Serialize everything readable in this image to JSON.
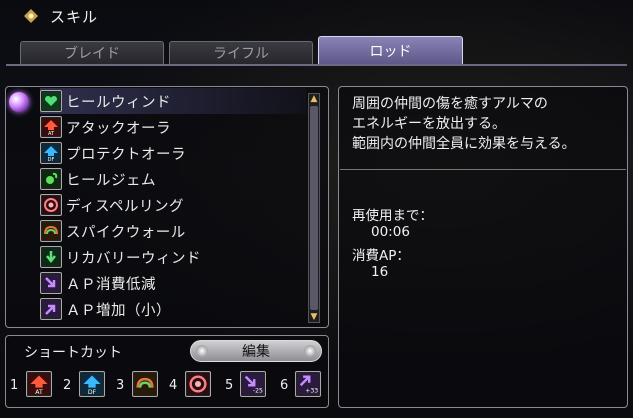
{
  "window": {
    "title": "スキル"
  },
  "tabs": [
    {
      "label": "ブレイド",
      "active": false
    },
    {
      "label": "ライフル",
      "active": false
    },
    {
      "label": "ロッド",
      "active": true
    }
  ],
  "skills": [
    {
      "label": "ヒールウィンド",
      "icon": "heal-wind-icon",
      "selected": true
    },
    {
      "label": "アタックオーラ",
      "icon": "attack-aura-icon"
    },
    {
      "label": "プロテクトオーラ",
      "icon": "protect-aura-icon"
    },
    {
      "label": "ヒールジェム",
      "icon": "heal-gem-icon"
    },
    {
      "label": "ディスペルリング",
      "icon": "dispel-ring-icon"
    },
    {
      "label": "スパイクウォール",
      "icon": "spike-wall-icon"
    },
    {
      "label": "リカバリーウィンド",
      "icon": "recovery-wind-icon"
    },
    {
      "label": "ＡＰ消費低減",
      "icon": "ap-cost-down-icon"
    },
    {
      "label": "ＡＰ増加（小）",
      "icon": "ap-up-icon"
    }
  ],
  "detail": {
    "description": [
      "周囲の仲間の傷を癒すアルマの",
      "エネルギーを放出する。",
      "範囲内の仲間全員に効果を与える。"
    ],
    "cooldown_label": "再使用まで：",
    "cooldown_value": "00:06",
    "ap_label": "消費AP：",
    "ap_value": "16"
  },
  "shortcut": {
    "title": "ショートカット",
    "edit_label": "編集",
    "slots": [
      {
        "num": "1",
        "icon": "attack-aura-icon"
      },
      {
        "num": "2",
        "icon": "protect-aura-icon"
      },
      {
        "num": "3",
        "icon": "spike-wall-icon"
      },
      {
        "num": "4",
        "icon": "dispel-ring-icon"
      },
      {
        "num": "5",
        "icon": "ap-cost-down-icon",
        "tag": "AP -25"
      },
      {
        "num": "6",
        "icon": "ap-up-icon",
        "tag": "AP +33"
      }
    ]
  },
  "colors": {
    "accent": "#6b659c",
    "panel_border": "#8a8a96",
    "tab_active": "#8a84b6"
  }
}
